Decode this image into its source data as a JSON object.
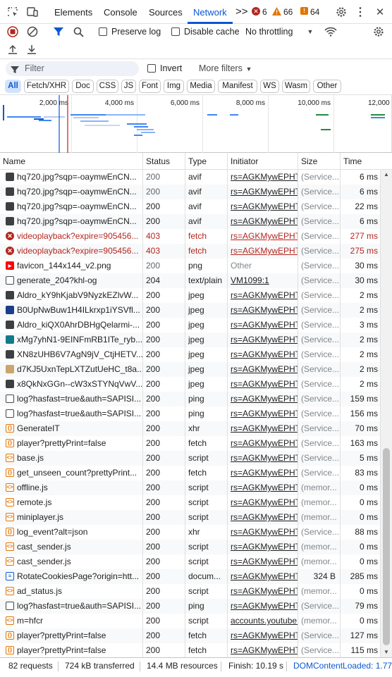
{
  "tabs": {
    "elements": "Elements",
    "console": "Console",
    "sources": "Sources",
    "network": "Network",
    "more": ">>"
  },
  "badges": {
    "errors": "6",
    "warnings": "66",
    "info": "64"
  },
  "toolbar": {
    "preserve_log": "Preserve log",
    "disable_cache": "Disable cache",
    "throttling": "No throttling"
  },
  "filter": {
    "placeholder": "Filter",
    "invert": "Invert",
    "more_filters": "More filters"
  },
  "type_filters": [
    "All",
    "Fetch/XHR",
    "Doc",
    "CSS",
    "JS",
    "Font",
    "Img",
    "Media",
    "Manifest",
    "WS",
    "Wasm",
    "Other"
  ],
  "timeline_ticks": [
    "2,000 ms",
    "4,000 ms",
    "6,000 ms",
    "8,000 ms",
    "10,000 ms",
    "12,000"
  ],
  "columns": {
    "name": "Name",
    "status": "Status",
    "type": "Type",
    "initiator": "Initiator",
    "size": "Size",
    "time": "Time"
  },
  "rows": [
    {
      "name": "hq720.jpg?sqp=-oaymwEnCN...",
      "status": "200",
      "type": "avif",
      "initiator": "rs=AGKMywEPHTI",
      "size": "(Service...",
      "time": "6 ms",
      "icon": "image",
      "error": false
    },
    {
      "name": "hq720.jpg?sqp=-oaymwEnCN...",
      "status": "200",
      "type": "avif",
      "initiator": "rs=AGKMywEPHTI",
      "size": "(Service...",
      "time": "6 ms",
      "icon": "image",
      "error": false
    },
    {
      "name": "hq720.jpg?sqp=-oaymwEnCN...",
      "status": "200",
      "type": "avif",
      "initiator": "rs=AGKMywEPHTI",
      "size": "(Service...",
      "time": "22 ms",
      "icon": "image",
      "error": false
    },
    {
      "name": "hq720.jpg?sqp=-oaymwEnCN...",
      "status": "200",
      "type": "avif",
      "initiator": "rs=AGKMywEPHTI",
      "size": "(Service...",
      "time": "6 ms",
      "icon": "image",
      "error": false
    },
    {
      "name": "videoplayback?expire=905456...",
      "status": "403",
      "type": "fetch",
      "initiator": "rs=AGKMywEPHTI",
      "size": "(Service...",
      "time": "277 ms",
      "icon": "error",
      "error": true
    },
    {
      "name": "videoplayback?expire=905456...",
      "status": "403",
      "type": "fetch",
      "initiator": "rs=AGKMywEPHTI",
      "size": "(Service...",
      "time": "275 ms",
      "icon": "error",
      "error": true
    },
    {
      "name": "favicon_144x144_v2.png",
      "status": "200",
      "type": "png",
      "initiator": "Other",
      "size": "(Service...",
      "time": "30 ms",
      "icon": "youtube",
      "error": false,
      "plain_init": true
    },
    {
      "name": "generate_204?khl-og",
      "status": "204",
      "type": "text/plain",
      "initiator": "VM1099:1",
      "size": "(Service...",
      "time": "30 ms",
      "icon": "blank",
      "error": false
    },
    {
      "name": "Aldro_kY9hKjabV9NyzkEZlvW...",
      "status": "200",
      "type": "jpeg",
      "initiator": "rs=AGKMywEPHTI",
      "size": "(Service...",
      "time": "2 ms",
      "icon": "image",
      "error": false
    },
    {
      "name": "B0UpNwBuw1H4ILkrxp1iYSVfl...",
      "status": "200",
      "type": "jpeg",
      "initiator": "rs=AGKMywEPHTI",
      "size": "(Service...",
      "time": "2 ms",
      "icon": "image-blue",
      "error": false
    },
    {
      "name": "Aldro_kiQX0AhrDBHgQelarmi-...",
      "status": "200",
      "type": "jpeg",
      "initiator": "rs=AGKMywEPHTI",
      "size": "(Service...",
      "time": "3 ms",
      "icon": "image",
      "error": false
    },
    {
      "name": "xMg7yhN1-9EINFmRB1ITe_ryb...",
      "status": "200",
      "type": "jpeg",
      "initiator": "rs=AGKMywEPHTI",
      "size": "(Service...",
      "time": "2 ms",
      "icon": "image-teal",
      "error": false
    },
    {
      "name": "XN8zUHB6V7AgN9jV_CtjHETV...",
      "status": "200",
      "type": "jpeg",
      "initiator": "rs=AGKMywEPHTI",
      "size": "(Service...",
      "time": "2 ms",
      "icon": "image",
      "error": false
    },
    {
      "name": "d7KJ5UxnTepLXTZutUeHC_t8a...",
      "status": "200",
      "type": "jpeg",
      "initiator": "rs=AGKMywEPHTI",
      "size": "(Service...",
      "time": "2 ms",
      "icon": "image-tan",
      "error": false
    },
    {
      "name": "x8QkNxGGn--cW3xSTYNqVwV...",
      "status": "200",
      "type": "jpeg",
      "initiator": "rs=AGKMywEPHTI",
      "size": "(Service...",
      "time": "2 ms",
      "icon": "image",
      "error": false
    },
    {
      "name": "log?hasfast=true&auth=SAPISI...",
      "status": "200",
      "type": "ping",
      "initiator": "rs=AGKMywEPHTI",
      "size": "(Service...",
      "time": "159 ms",
      "icon": "blank",
      "error": false
    },
    {
      "name": "log?hasfast=true&auth=SAPISI...",
      "status": "200",
      "type": "ping",
      "initiator": "rs=AGKMywEPHTI",
      "size": "(Service...",
      "time": "156 ms",
      "icon": "blank",
      "error": false
    },
    {
      "name": "GenerateIT",
      "status": "200",
      "type": "xhr",
      "initiator": "rs=AGKMywEPHTI",
      "size": "(Service...",
      "time": "70 ms",
      "icon": "fetch",
      "error": false
    },
    {
      "name": "player?prettyPrint=false",
      "status": "200",
      "type": "fetch",
      "initiator": "rs=AGKMywEPHTI",
      "size": "(Service...",
      "time": "163 ms",
      "icon": "fetch",
      "error": false
    },
    {
      "name": "base.js",
      "status": "200",
      "type": "script",
      "initiator": "rs=AGKMywEPHTI",
      "size": "(Service...",
      "time": "5 ms",
      "icon": "script",
      "error": false
    },
    {
      "name": "get_unseen_count?prettyPrint...",
      "status": "200",
      "type": "fetch",
      "initiator": "rs=AGKMywEPHTI",
      "size": "(Service...",
      "time": "83 ms",
      "icon": "fetch",
      "error": false
    },
    {
      "name": "offline.js",
      "status": "200",
      "type": "script",
      "initiator": "rs=AGKMywEPHTI",
      "size": "(memor...",
      "time": "0 ms",
      "icon": "script",
      "error": false
    },
    {
      "name": "remote.js",
      "status": "200",
      "type": "script",
      "initiator": "rs=AGKMywEPHTI",
      "size": "(memor...",
      "time": "0 ms",
      "icon": "script",
      "error": false
    },
    {
      "name": "miniplayer.js",
      "status": "200",
      "type": "script",
      "initiator": "rs=AGKMywEPHTI",
      "size": "(memor...",
      "time": "0 ms",
      "icon": "script",
      "error": false
    },
    {
      "name": "log_event?alt=json",
      "status": "200",
      "type": "xhr",
      "initiator": "rs=AGKMywEPHTI",
      "size": "(Service...",
      "time": "88 ms",
      "icon": "fetch",
      "error": false
    },
    {
      "name": "cast_sender.js",
      "status": "200",
      "type": "script",
      "initiator": "rs=AGKMywEPHTI",
      "size": "(memor...",
      "time": "0 ms",
      "icon": "script",
      "error": false
    },
    {
      "name": "cast_sender.js",
      "status": "200",
      "type": "script",
      "initiator": "rs=AGKMywEPHTI",
      "size": "(memor...",
      "time": "0 ms",
      "icon": "script",
      "error": false
    },
    {
      "name": "RotateCookiesPage?origin=htt...",
      "status": "200",
      "type": "docum...",
      "initiator": "rs=AGKMywEPHTI",
      "size": "324 B",
      "time": "285 ms",
      "icon": "doc",
      "error": false,
      "size_dark": true
    },
    {
      "name": "ad_status.js",
      "status": "200",
      "type": "script",
      "initiator": "rs=AGKMywEPHTI",
      "size": "(memor...",
      "time": "0 ms",
      "icon": "script",
      "error": false
    },
    {
      "name": "log?hasfast=true&auth=SAPISI...",
      "status": "200",
      "type": "ping",
      "initiator": "rs=AGKMywEPHTI",
      "size": "(Service...",
      "time": "79 ms",
      "icon": "blank",
      "error": false
    },
    {
      "name": "m=hfcr",
      "status": "200",
      "type": "script",
      "initiator": "accounts.youtube.",
      "size": "(memor...",
      "time": "0 ms",
      "icon": "script",
      "error": false
    },
    {
      "name": "player?prettyPrint=false",
      "status": "200",
      "type": "fetch",
      "initiator": "rs=AGKMywEPHTI",
      "size": "(Service...",
      "time": "127 ms",
      "icon": "fetch",
      "error": false
    },
    {
      "name": "player?prettyPrint=false",
      "status": "200",
      "type": "fetch",
      "initiator": "rs=AGKMywEPHTI",
      "size": "(Service...",
      "time": "115 ms",
      "icon": "fetch",
      "error": false
    }
  ],
  "statusbar": {
    "requests": "82 requests",
    "transferred": "724 kB transferred",
    "resources": "14.4 MB resources",
    "finish": "Finish: 10.19 s",
    "dcl": "DOMContentLoaded: 1.77"
  },
  "colors": {
    "accent": "#0b57d0",
    "error": "#b3261e",
    "warning": "#e37400"
  }
}
